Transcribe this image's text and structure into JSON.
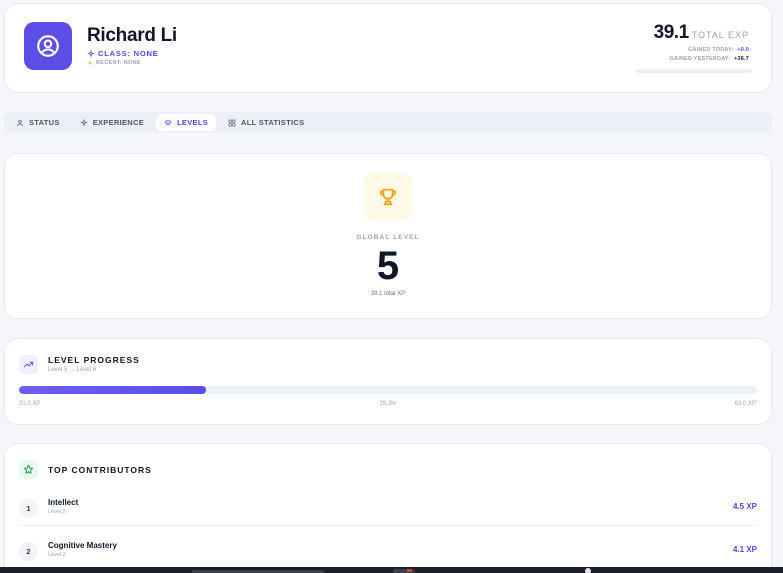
{
  "profile": {
    "name": "Richard Li",
    "class_text": "CLASS: NONE",
    "recent_text": "RECENT: NONE",
    "total_exp_value": "39.1",
    "total_exp_label": "TOTAL EXP",
    "gained_today_label": "GAINED TODAY:",
    "gained_today_value": "+0.0",
    "gained_yesterday_label": "GAINED YESTERDAY:",
    "gained_yesterday_value": "+36.7",
    "avatar_icon": "user-circle-icon",
    "accent_color": "#5b4ee8"
  },
  "tabs": [
    {
      "label": "STATUS",
      "icon": "user-icon",
      "active": false
    },
    {
      "label": "EXPERIENCE",
      "icon": "sparkle-icon",
      "active": false
    },
    {
      "label": "LEVELS",
      "icon": "layers-icon",
      "active": true
    },
    {
      "label": "ALL STATISTICS",
      "icon": "grid-icon",
      "active": false
    }
  ],
  "global_level": {
    "label": "GLOBAL LEVEL",
    "value": "5",
    "total_text": "39.1 total XP",
    "icon": "trophy-icon"
  },
  "level_progress": {
    "title": "LEVEL PROGRESS",
    "subtitle": "Level 5 → Level 6",
    "min_label": "31.0 XP",
    "percent_label": "25.3%",
    "max_label": "63.0 XP",
    "fraction": 0.253,
    "icon": "trending-up-icon"
  },
  "contributors": {
    "title": "TOP CONTRIBUTORS",
    "icon": "star-icon",
    "items": [
      {
        "rank": "1",
        "name": "Intellect",
        "level": "Level 2",
        "xp": "4.5 XP"
      },
      {
        "rank": "2",
        "name": "Cognitive Mastery",
        "level": "Level 2",
        "xp": "4.1 XP"
      }
    ]
  }
}
